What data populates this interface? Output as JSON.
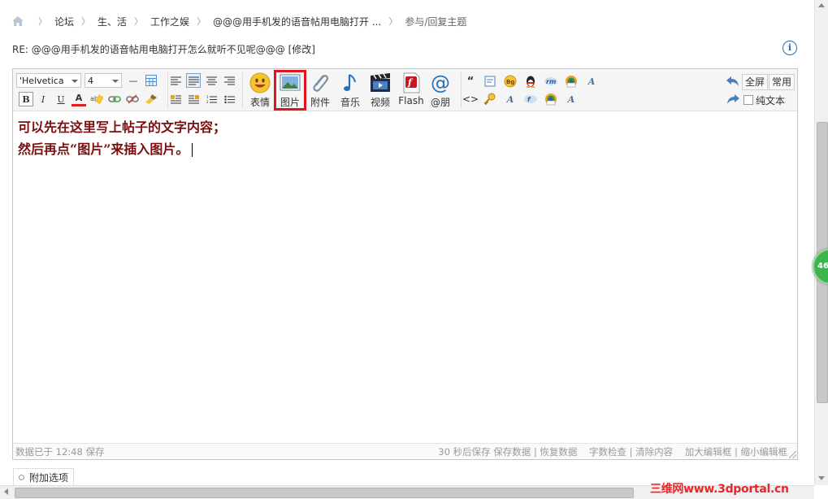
{
  "breadcrumb": {
    "items": [
      "论坛",
      "生、活",
      "工作之娱",
      "@@@用手机发的语音帖用电脑打开 ...",
      "参与/回复主题"
    ]
  },
  "title": "RE: @@@用手机发的语音帖用电脑打开怎么就听不见呢@@@ [修改]",
  "info_glyph": "i",
  "toolbar": {
    "font_family": "'Helvetica",
    "font_size": "4",
    "bold": "B",
    "italic": "I",
    "underline": "U",
    "text_color": "A",
    "hr": "—",
    "buttons": {
      "emoji": "表情",
      "image": "图片",
      "attach": "附件",
      "music": "音乐",
      "video": "视频",
      "flash": "Flash",
      "mention": "@朋"
    },
    "right": {
      "fullscreen": "全屏",
      "common": "常用",
      "plain_text": "纯文本"
    }
  },
  "content": {
    "line1": "可以先在这里写上帖子的文字内容；",
    "line2": "然后再点“图片”来插入图片。"
  },
  "statusbar": {
    "left": "数据已于 12:48 保存",
    "right": "30 秒后保存 保存数据 | 恢复数据    字数检查 | 清除内容    加大编辑框 | 缩小编辑框"
  },
  "extra_options": "附加选项",
  "float_badge": "46",
  "watermark": "三维网www.3dportal.cn",
  "colors": {
    "highlight": "#e0141e",
    "content_text": "#7a0f0f",
    "accent": "#2b6ab3"
  }
}
